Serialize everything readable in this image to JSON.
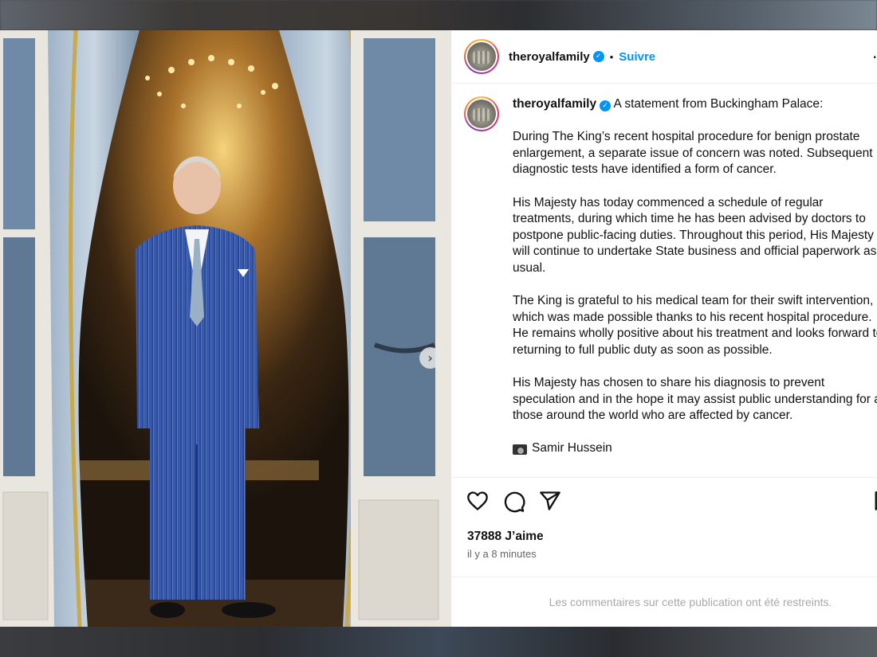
{
  "post": {
    "username": "theroyalfamily",
    "verified_mark": "✓",
    "separator": "•",
    "follow_label": "Suivre",
    "more_icon": "···",
    "caption_intro": " A statement from Buckingham Palace:",
    "paragraphs": [
      "During The King’s recent hospital procedure for benign prostate enlargement, a separate issue of concern was noted. Subsequent diagnostic tests have identified a form of cancer.",
      "His Majesty has today commenced a schedule of regular treatments, during which time he has been advised by doctors to postpone public-facing duties. Throughout this period, His Majesty will continue to undertake State business and official paperwork as usual.",
      "The King is grateful to his medical team for their swift intervention, which was made possible thanks to his recent hospital procedure. He remains wholly positive about his treatment and looks forward to returning to full public duty as soon as possible.",
      "His Majesty has chosen to share his diagnosis to prevent speculation and in the hope it may assist public understanding for all those around the world who are affected by cancer."
    ],
    "credit": "Samir Hussein",
    "likes": "37888 J’aime",
    "timestamp": "il y a 8 minutes",
    "comments_restricted": "Les commentaires sur cette publication ont été restreints.",
    "carousel_next": "›",
    "carousel_current": 1,
    "carousel_total": 2
  },
  "icons": {
    "heart": "heart-icon",
    "comment": "comment-icon",
    "share": "share-icon",
    "save": "bookmark-icon",
    "camera": "camera-icon"
  },
  "colors": {
    "accent": "#0095f6",
    "muted": "#a8a8a8"
  }
}
